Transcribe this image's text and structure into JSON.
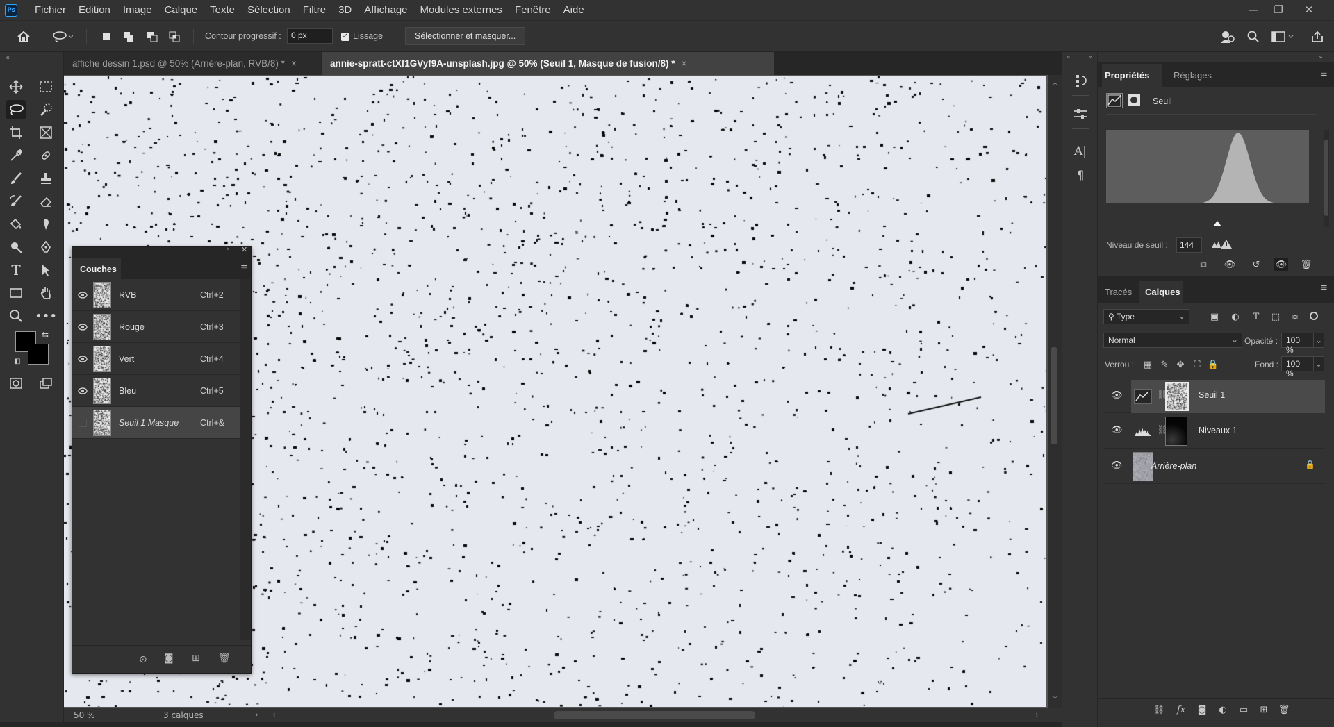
{
  "app": {
    "logo_text": "Ps"
  },
  "menu": [
    "Fichier",
    "Edition",
    "Image",
    "Calque",
    "Texte",
    "Sélection",
    "Filtre",
    "3D",
    "Affichage",
    "Modules externes",
    "Fenêtre",
    "Aide"
  ],
  "options_bar": {
    "feather_label": "Contour progressif :",
    "feather_value": "0 px",
    "smoothing_label": "Lissage",
    "smoothing_checked": true,
    "select_mask_button": "Sélectionner et masquer..."
  },
  "doc_tabs": [
    {
      "label": "affiche dessin 1.psd @ 50% (Arrière-plan, RVB/8) *",
      "close": "×",
      "active": false
    },
    {
      "label": "annie-spratt-ctXf1GVyf9A-unsplash.jpg @ 50% (Seuil 1, Masque de fusion/8) *",
      "close": "×",
      "active": true
    }
  ],
  "status": {
    "zoom": "50 %",
    "layer_count": "3 calques"
  },
  "channels_panel": {
    "title": "Couches",
    "rows": [
      {
        "name": "RVB",
        "shortcut": "Ctrl+2",
        "visible": true
      },
      {
        "name": "Rouge",
        "shortcut": "Ctrl+3",
        "visible": true
      },
      {
        "name": "Vert",
        "shortcut": "Ctrl+4",
        "visible": true
      },
      {
        "name": "Bleu",
        "shortcut": "Ctrl+5",
        "visible": true
      },
      {
        "name": "Seuil 1 Masque",
        "shortcut": "Ctrl+&",
        "visible": false
      }
    ]
  },
  "properties_panel": {
    "tabs": [
      "Propriétés",
      "Réglages"
    ],
    "active_tab": "Propriétés",
    "adjustment_name": "Seuil",
    "threshold_label": "Niveau de seuil :",
    "threshold_value": "144"
  },
  "layers_panel": {
    "tabs": [
      "Tracés",
      "Calques"
    ],
    "active_tab": "Calques",
    "filter_kind": "Type",
    "blend_mode": "Normal",
    "opacity_label": "Opacité :",
    "opacity_value": "100 %",
    "lock_label": "Verrou :",
    "fill_label": "Fond :",
    "fill_value": "100 %",
    "layers": [
      {
        "name": "Seuil 1",
        "type": "threshold",
        "selected": true
      },
      {
        "name": "Niveaux 1",
        "type": "levels",
        "selected": false
      },
      {
        "name": "Arrière-plan",
        "type": "background",
        "locked": true,
        "selected": false
      }
    ]
  },
  "colors": {
    "accent": "#31a8ff",
    "foreground_color": "#000000",
    "background_color": "#000000",
    "canvas_paper": "#e6e8ef"
  }
}
